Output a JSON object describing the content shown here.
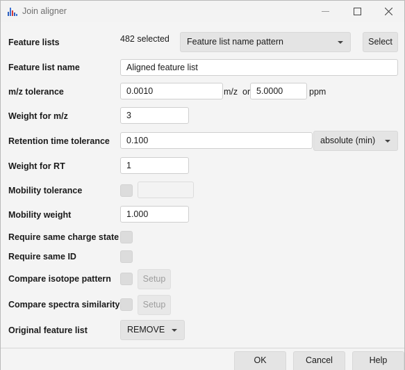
{
  "window": {
    "title": "Join aligner",
    "controls": {
      "minimize_icon": "minimize-icon",
      "maximize_icon": "maximize-icon",
      "close_icon": "close-icon"
    }
  },
  "form": {
    "feature_lists": {
      "label": "Feature lists",
      "count_text": "482 selected",
      "selector_value": "Feature list name pattern",
      "select_button": "Select"
    },
    "feature_list_name": {
      "label": "Feature list name",
      "value": "Aligned feature list"
    },
    "mz_tolerance": {
      "label": "m/z tolerance",
      "value": "0.0010",
      "unit": "m/z",
      "or_text": "or",
      "ppm_value": "5.0000",
      "ppm_unit": "ppm"
    },
    "weight_mz": {
      "label": "Weight for m/z",
      "value": "3"
    },
    "rt_tolerance": {
      "label": "Retention time tolerance",
      "value": "0.100",
      "mode": "absolute (min)"
    },
    "weight_rt": {
      "label": "Weight for RT",
      "value": "1"
    },
    "mobility_tolerance": {
      "label": "Mobility tolerance",
      "checked": false,
      "value": ""
    },
    "mobility_weight": {
      "label": "Mobility weight",
      "value": "1.000"
    },
    "same_charge": {
      "label": "Require same charge state",
      "checked": false
    },
    "same_id": {
      "label": "Require same ID",
      "checked": false
    },
    "isotope_pattern": {
      "label": "Compare isotope pattern",
      "checked": false,
      "setup_button": "Setup"
    },
    "spectra_similarity": {
      "label": "Compare spectra similarity",
      "checked": false,
      "setup_button": "Setup"
    },
    "original_list": {
      "label": "Original feature list",
      "value": "REMOVE"
    }
  },
  "footer": {
    "ok": "OK",
    "cancel": "Cancel",
    "help": "Help"
  },
  "colors": {
    "background": "#f4f4f4",
    "button": "#e4e4e4",
    "field": "#ffffff",
    "checkbox": "#dcdcdc"
  }
}
